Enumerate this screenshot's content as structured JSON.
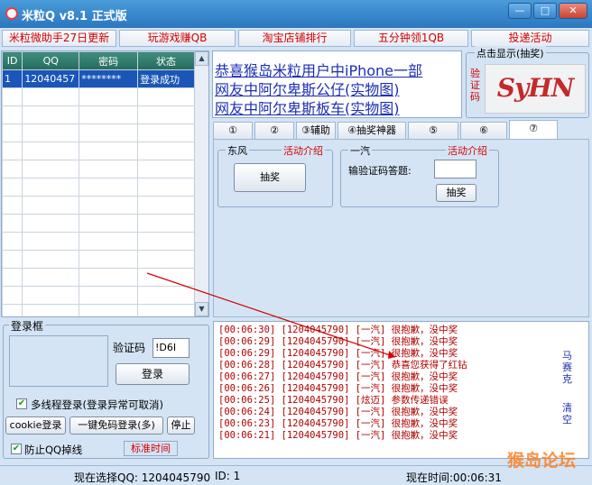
{
  "window": {
    "title": "米粒Q v8.1 正式版",
    "min": "—",
    "max": "□",
    "close": "✕"
  },
  "toplinks": [
    "米粒微助手27日更新",
    "玩游戏赚QB",
    "淘宝店铺排行",
    "五分钟领1QB",
    "投递活动"
  ],
  "accounts": {
    "headers": [
      "ID",
      "QQ",
      "密码",
      "状态"
    ],
    "rows": [
      {
        "id": "1",
        "qq": "12040457",
        "pwd": "********",
        "status": "登录成功"
      }
    ]
  },
  "promos": [
    "恭喜猴岛米粒用户中iPhone一部",
    "网友中阿尔卑斯公仔(实物图)",
    "网友中阿尔卑斯板车(实物图)"
  ],
  "captcha": {
    "title": "点击显示(抽奖)",
    "side_label": "验证码",
    "text": "SyHN"
  },
  "tabs": [
    "①",
    "②",
    "③辅助",
    "④抽奖神器",
    "⑤",
    "⑥",
    "⑦"
  ],
  "active_tab": 6,
  "panel": {
    "g1": {
      "title": "东风",
      "link": "活动介绍",
      "button": "抽奖"
    },
    "g2": {
      "title": "一汽",
      "link": "活动介绍",
      "prompt": "输验证码答题:",
      "button": "抽奖"
    }
  },
  "login": {
    "title": "登录框",
    "captcha_label": "验证码",
    "captcha_value": "!D6I",
    "login_button": "登录",
    "multi_thread_label": "多线程登录(登录异常可取消)",
    "multi_thread_checked": true,
    "cookie_button": "cookie登录",
    "oneclick_button": "一键免码登录(多)",
    "stop_button": "停止",
    "anti_drop_label": "防止QQ掉线",
    "anti_drop_checked": true,
    "std_time": "标准时间"
  },
  "log": [
    "[00:06:30] [1204045790] [一汽] 很抱歉，没中奖",
    "[00:06:29] [1204045790] [一汽] 很抱歉，没中奖",
    "[00:06:29] [1204045790] [一汽] 很抱歉，没中奖",
    "[00:06:28] [1204045790] [一汽] 恭喜您获得了红钻",
    "[00:06:27] [1204045790] [一汽] 很抱歉，没中奖",
    "[00:06:26] [1204045790] [一汽] 很抱歉，没中奖",
    "[00:06:25] [1204045790] [炫迈] 参数传递错误",
    "[00:06:24] [1204045790] [一汽] 很抱歉，没中奖",
    "[00:06:23] [1204045790] [一汽] 很抱歉，没中奖",
    "[00:06:21] [1204045790] [一汽] 很抱歉，没中奖"
  ],
  "log_side": {
    "top": "马赛克",
    "bottom": "清空"
  },
  "status": {
    "selected_qq": "现在选择QQ: 1204045790",
    "id": "ID: 1",
    "time": "现在时间:00:06:31"
  },
  "watermark": "猴岛论坛",
  "colors": {
    "accent": "#2b77c0",
    "red": "#d40000",
    "link": "#1c2fb5",
    "selected_row": "#1a56b8"
  }
}
